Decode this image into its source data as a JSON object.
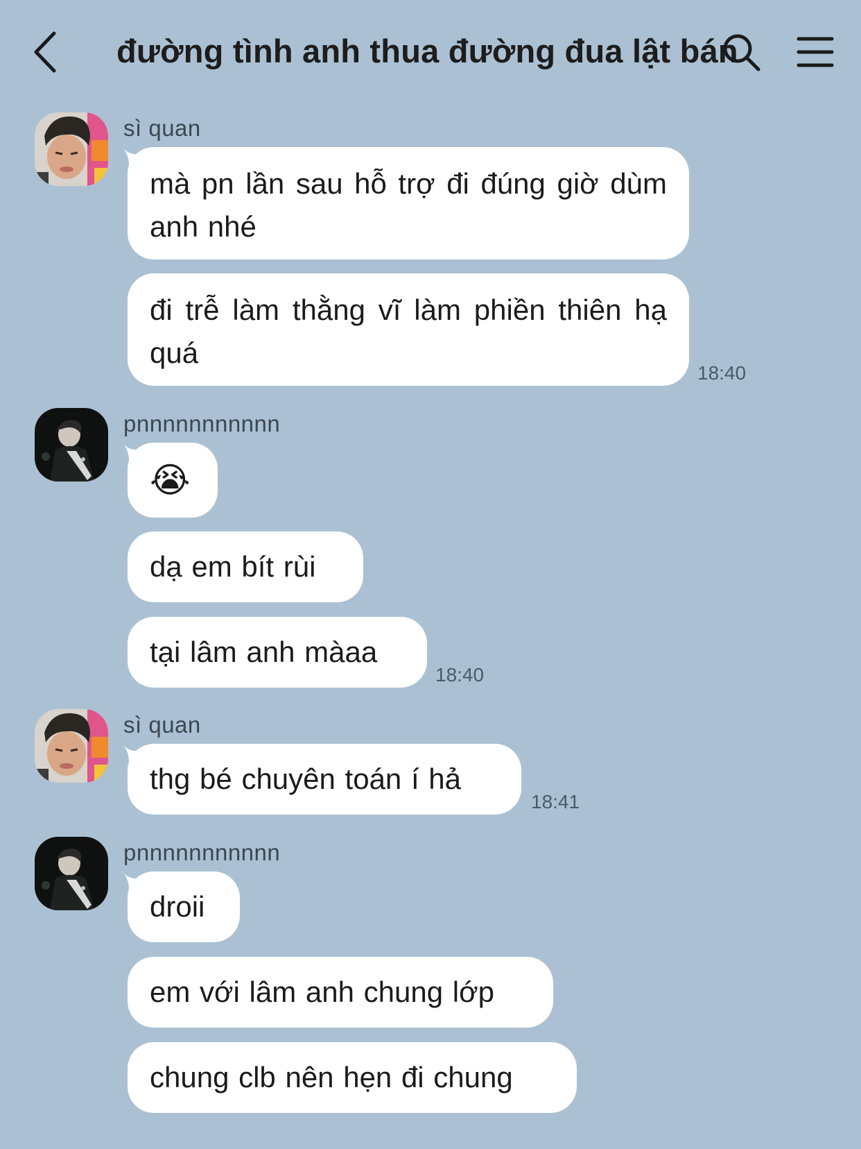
{
  "header": {
    "title": "đường tình anh thua đường đua lật bánh"
  },
  "icons": {
    "back": "chevron-left-icon",
    "search": "search-icon",
    "menu": "hamburger-menu-icon"
  },
  "messages": [
    {
      "sender": "sì quan",
      "bubbles": [
        "mà pn lần sau hỗ trợ đi đúng giờ dùm anh nhé",
        "đi trễ làm thằng vĩ làm phiền thiên hạ quá"
      ],
      "time": "18:40"
    },
    {
      "sender": "pnnnnnnnnnnn",
      "bubbles": [
        "😭",
        "dạ em bít rùi",
        "tại lâm anh màaa"
      ],
      "time": "18:40"
    },
    {
      "sender": "sì quan",
      "bubbles": [
        "thg bé chuyên toán í hả"
      ],
      "time": "18:41"
    },
    {
      "sender": "pnnnnnnnnnnn",
      "bubbles": [
        "droii",
        "em với lâm anh chung lớp",
        "chung clb nên hẹn đi chung"
      ]
    }
  ],
  "colors": {
    "background": "#abc1d3",
    "bubble": "#ffffff",
    "text": "#1b1b1b",
    "time": "#4b5a67"
  }
}
